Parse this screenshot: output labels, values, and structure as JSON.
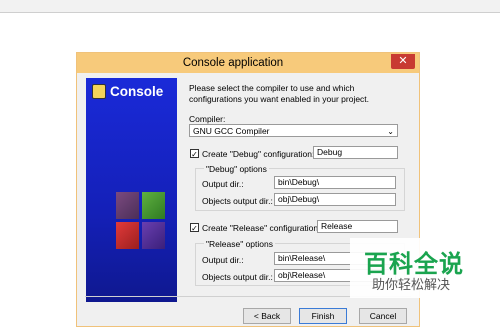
{
  "window": {
    "title": "Console application",
    "close_symbol": "✕"
  },
  "banner": {
    "title": "Console"
  },
  "description": "Please select the compiler to use and which configurations you want enabled in your project.",
  "compiler": {
    "label": "Compiler:",
    "selected": "GNU GCC Compiler"
  },
  "debug": {
    "checkbox_label": "Create \"Debug\" configuration:",
    "checked": true,
    "name_value": "Debug",
    "options_title": "\"Debug\" options",
    "output_label": "Output dir.:",
    "output_value": "bin\\Debug\\",
    "objects_label": "Objects output dir.:",
    "objects_value": "obj\\Debug\\"
  },
  "release": {
    "checkbox_label": "Create \"Release\" configuration:",
    "checked": true,
    "name_value": "Release",
    "options_title": "\"Release\" options",
    "output_label": "Output dir.:",
    "output_value": "bin\\Release\\",
    "objects_label": "Objects output dir.:",
    "objects_value": "obj\\Release\\"
  },
  "buttons": {
    "back": "< Back",
    "finish": "Finish",
    "cancel": "Cancel"
  },
  "watermark": {
    "main": "百科全说",
    "sub": "助你轻松解决"
  },
  "colors": {
    "titlebar": "#f7ca7b",
    "close": "#c83a32",
    "banner": "#1a2ad8",
    "watermark": "#1aa44f"
  }
}
